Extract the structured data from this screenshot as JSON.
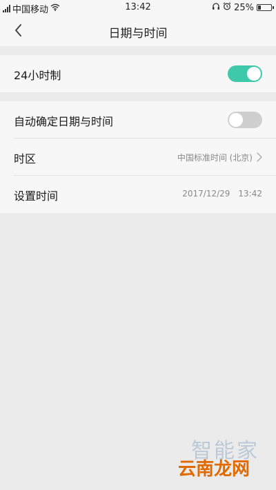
{
  "status_bar": {
    "carrier": "中国移动",
    "time": "13:42",
    "battery_percent": "25%",
    "icons": [
      "signal-icon",
      "wifi-icon",
      "headphones-icon",
      "alarm-icon",
      "battery-icon"
    ],
    "battery_level": 0.25
  },
  "header": {
    "title": "日期与时间",
    "back_icon": "chevron-left-icon"
  },
  "settings": {
    "hour24": {
      "label": "24小时制",
      "enabled": true
    },
    "auto_datetime": {
      "label": "自动确定日期与时间",
      "enabled": false
    },
    "timezone": {
      "label": "时区",
      "value": "中国标准时间 (北京)"
    },
    "set_time": {
      "label": "设置时间",
      "date": "2017/12/29",
      "time": "13:42"
    }
  },
  "watermark": {
    "top": "智能家",
    "bottom": "云南龙网"
  },
  "colors": {
    "accent": "#3ec9aa",
    "toggle_off": "#cfcfcf",
    "background": "#ebebeb",
    "section_bg": "#f7f7f7",
    "secondary_text": "#888888",
    "watermark_orange": "#e06a00"
  }
}
